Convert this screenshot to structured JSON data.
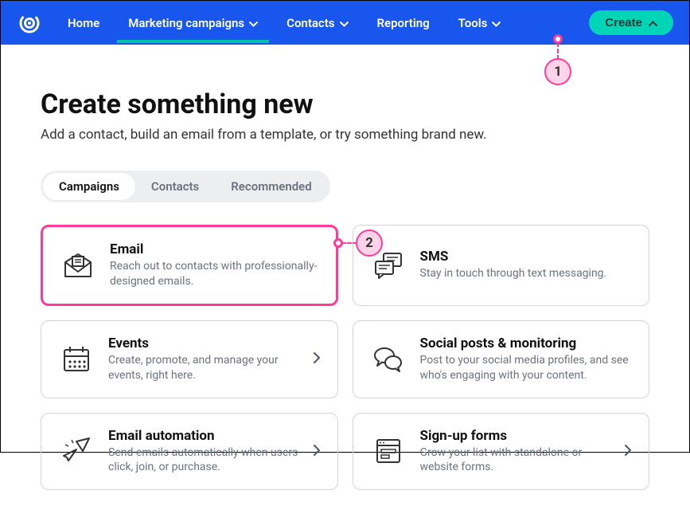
{
  "nav": {
    "items": [
      {
        "label": "Home",
        "dropdown": false
      },
      {
        "label": "Marketing campaigns",
        "dropdown": true,
        "active": true
      },
      {
        "label": "Contacts",
        "dropdown": true
      },
      {
        "label": "Reporting",
        "dropdown": false
      },
      {
        "label": "Tools",
        "dropdown": true
      }
    ],
    "create_label": "Create"
  },
  "page": {
    "title": "Create something new",
    "subtitle": "Add a contact, build an email from a template, or try something brand new."
  },
  "tabs": [
    {
      "label": "Campaigns",
      "active": true
    },
    {
      "label": "Contacts"
    },
    {
      "label": "Recommended"
    }
  ],
  "cards": [
    {
      "title": "Email",
      "desc": "Reach out to contacts with professionally-designed emails.",
      "selected": true,
      "arrow": false
    },
    {
      "title": "SMS",
      "desc": "Stay in touch through text messaging.",
      "arrow": false
    },
    {
      "title": "Events",
      "desc": "Create, promote, and manage your events, right here.",
      "arrow": true
    },
    {
      "title": "Social posts & monitoring",
      "desc": "Post to your social media profiles, and see who's engaging with your content.",
      "arrow": false
    },
    {
      "title": "Email automation",
      "desc": "Send emails automatically when users click, join, or purchase.",
      "arrow": true
    },
    {
      "title": "Sign-up forms",
      "desc": "Grow your list with standalone or website forms.",
      "arrow": true
    }
  ],
  "annotations": {
    "a1": "1",
    "a2": "2"
  }
}
